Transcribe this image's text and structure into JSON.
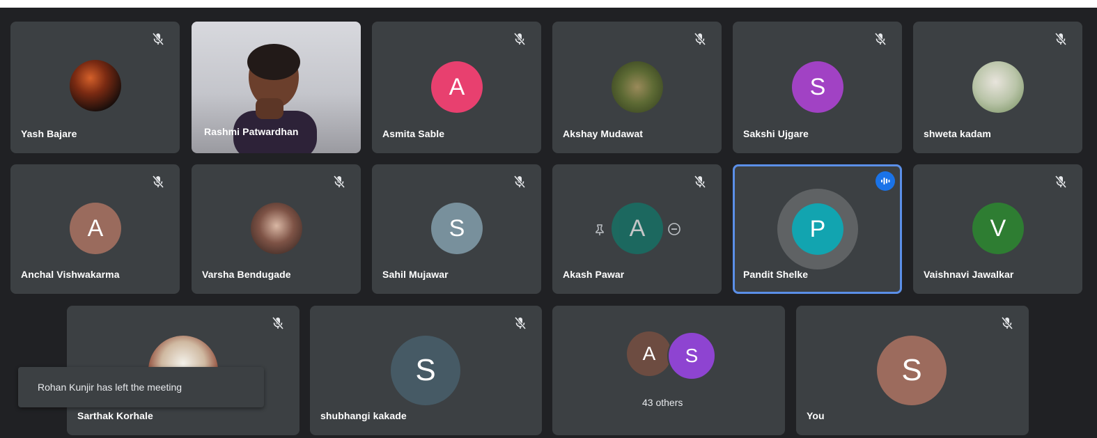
{
  "participants": [
    {
      "name": "Yash Bajare"
    },
    {
      "name": "Rashmi Patwardhan"
    },
    {
      "name": "Asmita Sable",
      "initial": "A",
      "color": "#e8406f"
    },
    {
      "name": "Akshay Mudawat"
    },
    {
      "name": "Sakshi Ujgare",
      "initial": "S",
      "color": "#a142c4"
    },
    {
      "name": "shweta kadam"
    },
    {
      "name": "Anchal Vishwakarma",
      "initial": "A",
      "color": "#9a6b5d"
    },
    {
      "name": "Varsha Bendugade"
    },
    {
      "name": "Sahil Mujawar",
      "initial": "S",
      "color": "#78909c"
    },
    {
      "name": "Akash Pawar",
      "initial": "A",
      "color": "#0f7a6b"
    },
    {
      "name": "Pandit Shelke",
      "initial": "P",
      "color": "#12a4b0"
    },
    {
      "name": "Vaishnavi Jawalkar",
      "initial": "V",
      "color": "#2e7d32"
    },
    {
      "name": "Sarthak Korhale"
    },
    {
      "name": "shubhangi kakade",
      "initial": "S",
      "color": "#465a65"
    },
    {
      "name": "You",
      "initial": "S",
      "color": "#9c6b5d"
    }
  ],
  "others": {
    "label": "43 others",
    "avatars": [
      {
        "initial": "A",
        "color": "#6d4c41"
      },
      {
        "initial": "S",
        "color": "#8e44d1"
      }
    ]
  },
  "notification": {
    "text": "Rohan Kunjir has left the meeting"
  }
}
